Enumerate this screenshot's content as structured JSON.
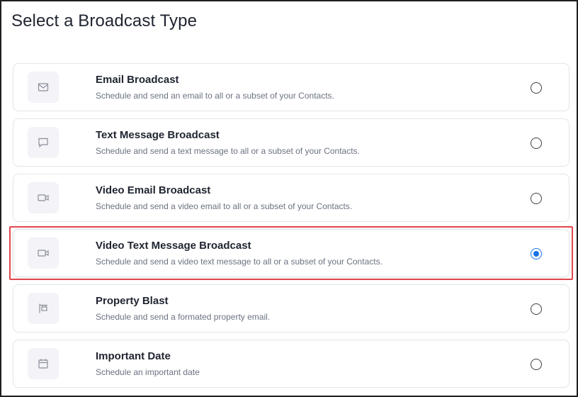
{
  "page": {
    "title": "Select a Broadcast Type"
  },
  "options": [
    {
      "title": "Email Broadcast",
      "description": "Schedule and send an email to all or a subset of your Contacts.",
      "icon": "envelope-icon",
      "selected": false
    },
    {
      "title": "Text Message Broadcast",
      "description": "Schedule and send a text message to all or a subset of your Contacts.",
      "icon": "chat-bubble-icon",
      "selected": false
    },
    {
      "title": "Video Email Broadcast",
      "description": "Schedule and send a video email to all or a subset of your Contacts.",
      "icon": "video-camera-icon",
      "selected": false
    },
    {
      "title": "Video Text Message Broadcast",
      "description": "Schedule and send a video text message to all or a subset of your Contacts.",
      "icon": "video-camera-icon",
      "selected": true
    },
    {
      "title": "Property Blast",
      "description": "Schedule and send a formated property email.",
      "icon": "property-sign-icon",
      "selected": false
    },
    {
      "title": "Important Date",
      "description": "Schedule an important date",
      "icon": "calendar-icon",
      "selected": false
    }
  ],
  "colors": {
    "accent": "#1a73e8",
    "highlight": "#e0474c",
    "icon_bg": "#f3f3f8"
  }
}
